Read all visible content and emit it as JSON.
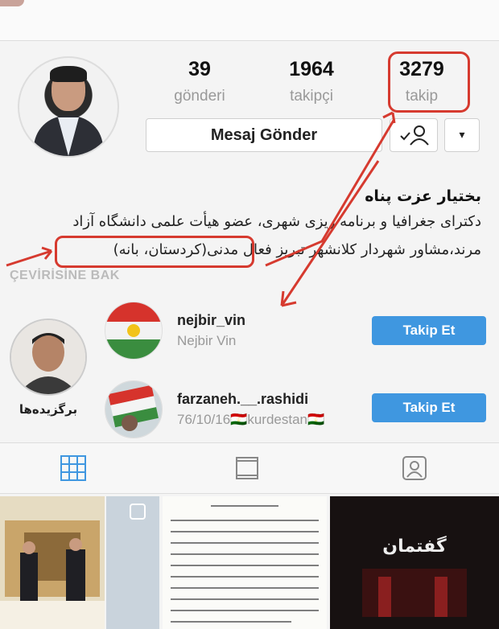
{
  "stats": [
    {
      "count": "39",
      "label": "gönderi"
    },
    {
      "count": "1964",
      "label": "takipçi"
    },
    {
      "count": "3279",
      "label": "takip"
    }
  ],
  "buttons": {
    "message": "Mesaj Gönder",
    "dropdown_icon": "▾"
  },
  "profile": {
    "name": "بختیار عزت پناه",
    "bio_line1": "دکترای جغرافیا و برنامه ریزی شهری، عضو هیأت علمی دانشگاه آزاد",
    "bio_line2": "مرند،مشاور شهردار کلانشهر تبریز فعال مدنی(کردستان، بانه)",
    "translate": "ÇEVİRİSİNE BAK"
  },
  "highlight": {
    "label": "برگزیده‌ها"
  },
  "suggestions": [
    {
      "username": "nejbir_vin",
      "subtitle": "Nejbir Vin",
      "button": "Takip Et"
    },
    {
      "username": "farzaneh.__.rashidi",
      "subtitle": "76/10/16🇹🇯kurdestan🇹🇯",
      "button": "Takip Et"
    }
  ],
  "tabs": [
    {
      "icon": "grid-icon",
      "active": true
    },
    {
      "icon": "feed-icon",
      "active": false
    },
    {
      "icon": "tagged-icon",
      "active": false
    }
  ],
  "tiles": {
    "tile3_text": "گفتمان"
  },
  "colors": {
    "accent": "#3f97e0",
    "annotation": "#d63a2f",
    "muted": "#999999"
  }
}
